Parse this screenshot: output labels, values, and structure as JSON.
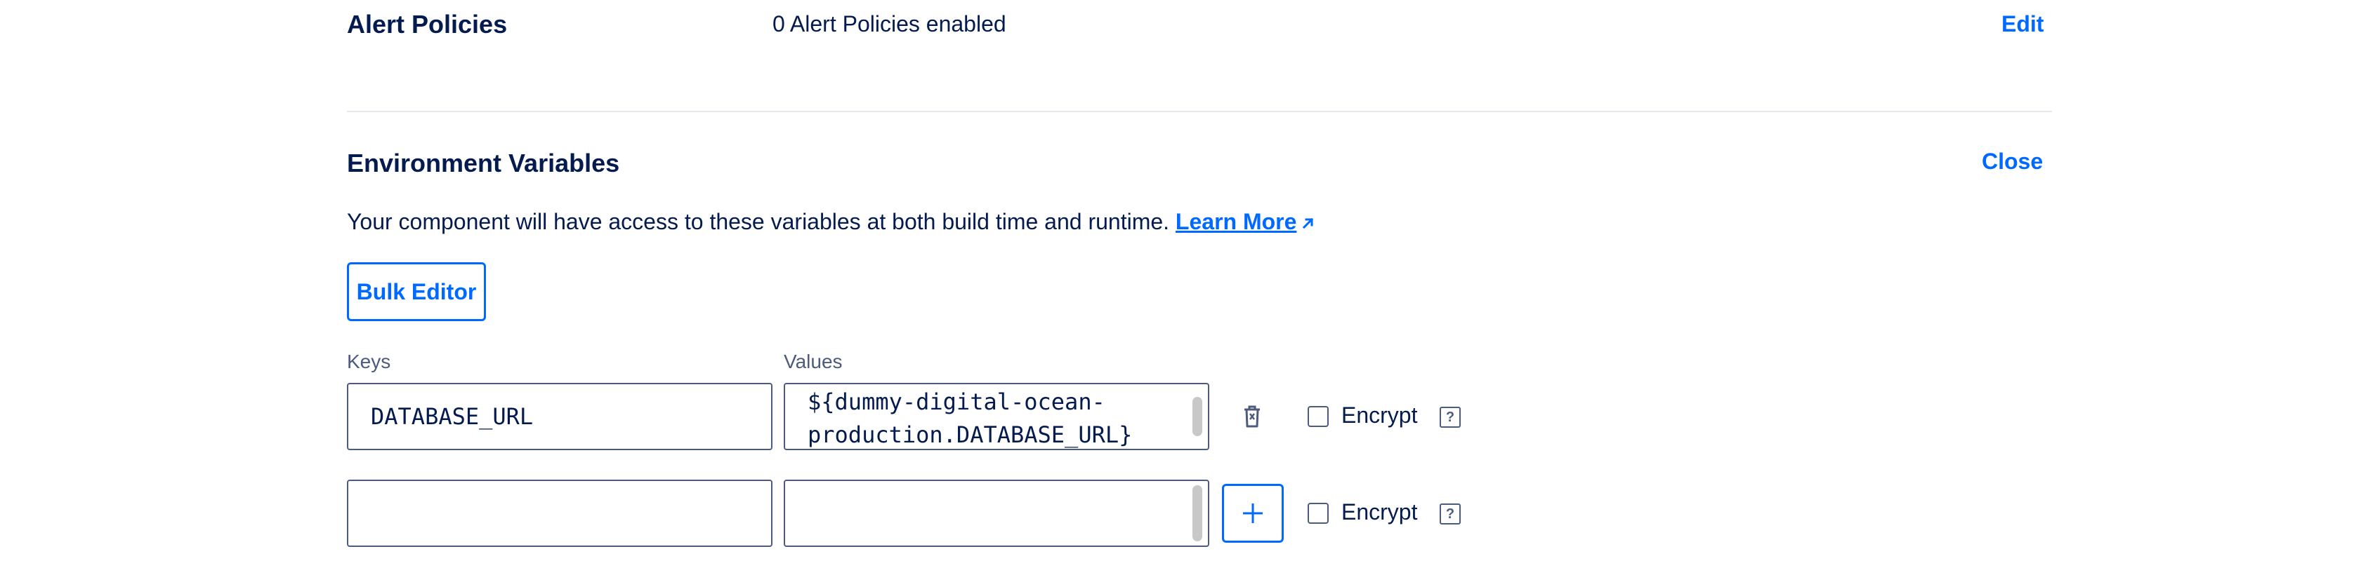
{
  "alert_policies": {
    "title": "Alert Policies",
    "status": "0 Alert Policies enabled",
    "edit_label": "Edit"
  },
  "env_vars": {
    "title": "Environment Variables",
    "close_label": "Close",
    "description": "Your component will have access to these variables at both build time and runtime.",
    "learn_more": "Learn More",
    "bulk_editor_label": "Bulk Editor",
    "keys_header": "Keys",
    "values_header": "Values",
    "rows": [
      {
        "key": "DATABASE_URL",
        "value": "${dummy-digital-ocean-production.DATABASE_URL}",
        "encrypt_label": "Encrypt",
        "help": "?",
        "encrypted": false
      },
      {
        "key": "",
        "value": "",
        "encrypt_label": "Encrypt",
        "help": "?",
        "encrypted": false
      }
    ]
  },
  "colors": {
    "accent": "#0069ff",
    "text": "#031b4e",
    "muted": "#4d5b7c",
    "divider": "#e5e8ed"
  },
  "icons": {
    "delete": "trash-icon",
    "add": "plus-icon",
    "external": "external-link-icon"
  }
}
